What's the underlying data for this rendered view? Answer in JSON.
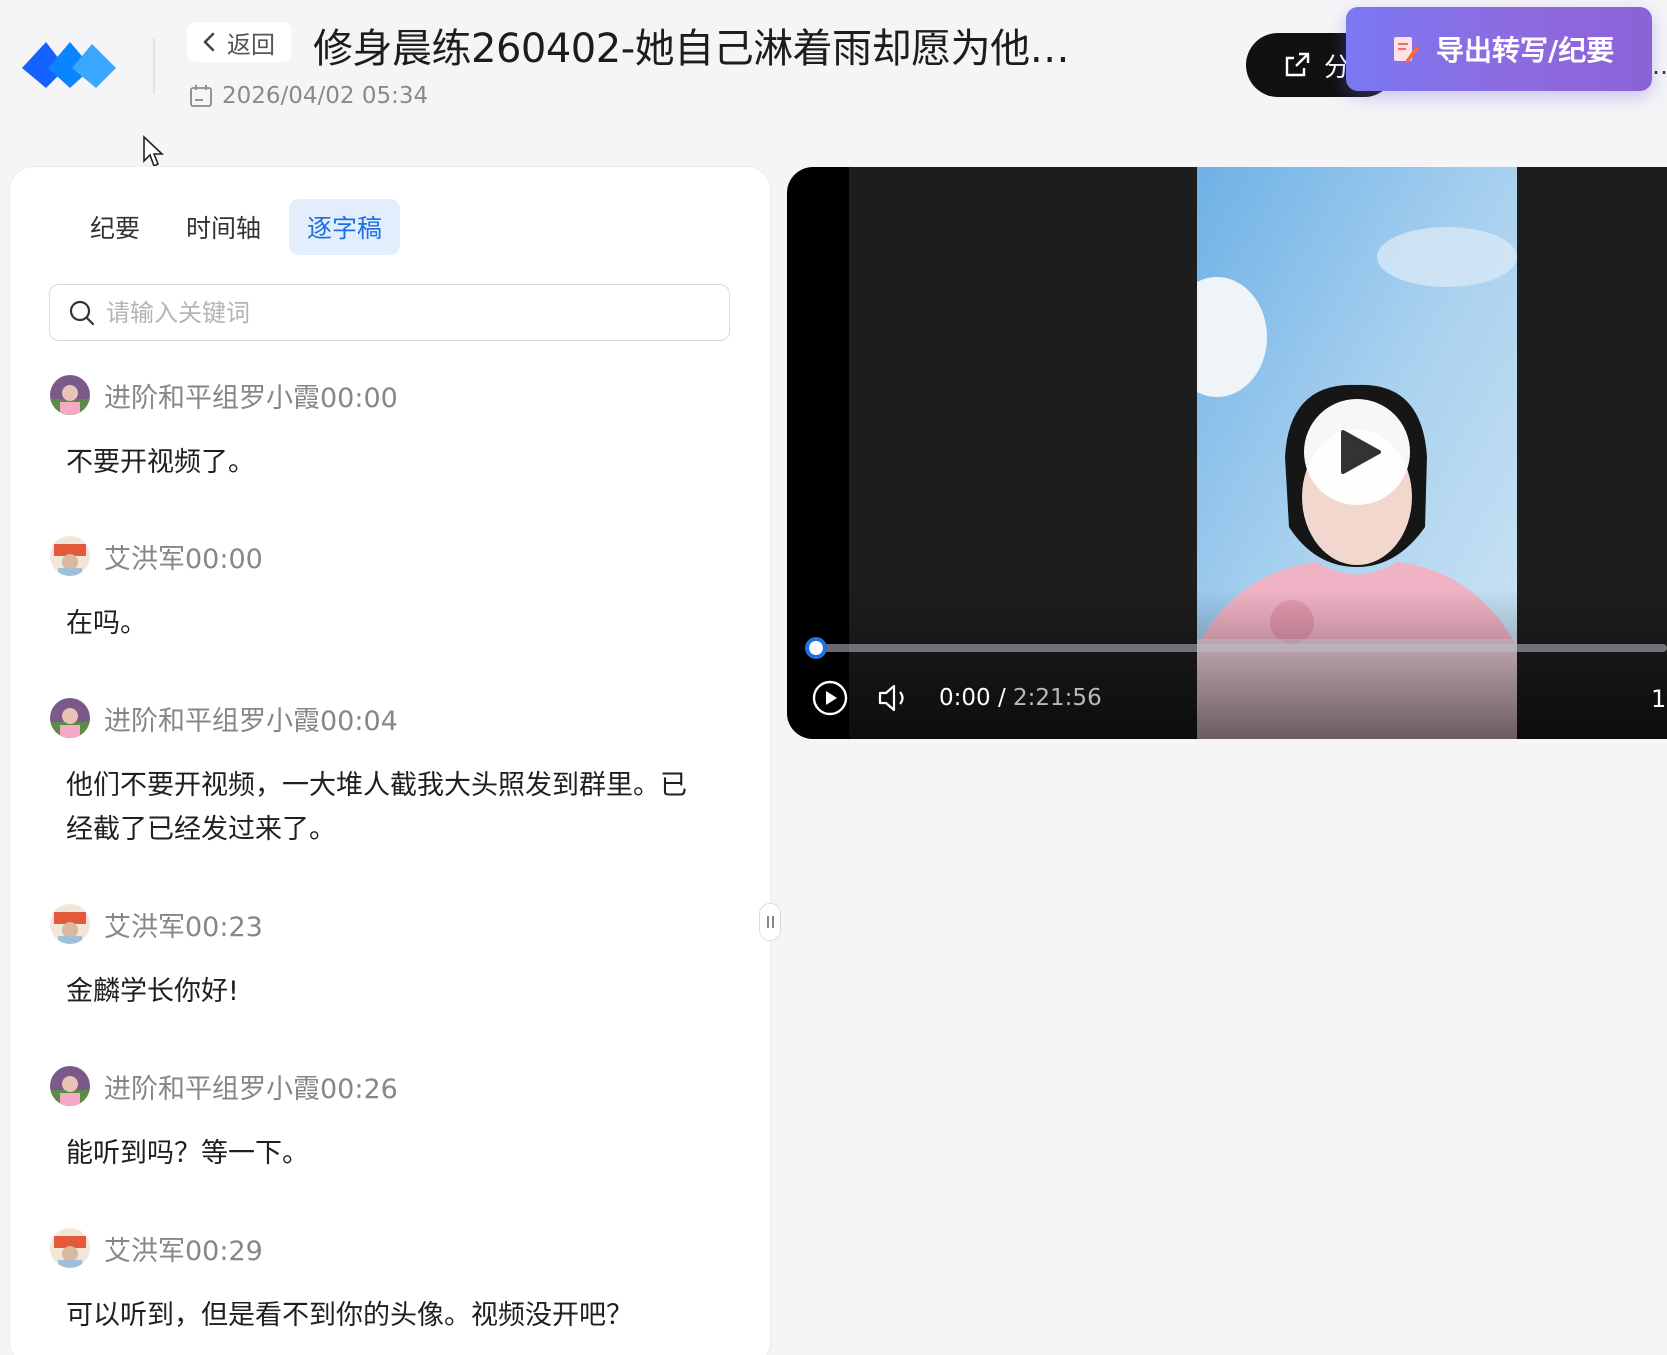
{
  "header": {
    "back_label": "返回",
    "title": "修身晨练260402-她自己淋着雨却愿为他…",
    "date": "2026/04/02 05:34",
    "share_label": "分",
    "export_label": "导出转写/纪要",
    "edge_glyph": "…"
  },
  "tabs": [
    {
      "label": "纪要",
      "active": false
    },
    {
      "label": "时间轴",
      "active": false
    },
    {
      "label": "逐字稿",
      "active": true
    }
  ],
  "search": {
    "placeholder": "请输入关键词",
    "value": ""
  },
  "transcript": [
    {
      "speaker": "进阶和平组罗小霞",
      "time": "00:00",
      "text": "不要开视频了。"
    },
    {
      "speaker": "艾洪军",
      "time": "00:00",
      "text": "在吗。"
    },
    {
      "speaker": "进阶和平组罗小霞",
      "time": "00:04",
      "text": "他们不要开视频，一大堆人截我大头照发到群里。已经截了已经发过来了。"
    },
    {
      "speaker": "艾洪军",
      "time": "00:23",
      "text": "金麟学长你好!"
    },
    {
      "speaker": "进阶和平组罗小霞",
      "time": "00:26",
      "text": "能听到吗？等一下。"
    },
    {
      "speaker": "艾洪军",
      "time": "00:29",
      "text": "可以听到，但是看不到你的头像。视频没开吧？"
    }
  ],
  "player": {
    "current": "0:00",
    "separator": " / ",
    "total": "2:21:56",
    "progress_fraction": 0.004,
    "speed_label": "1"
  },
  "colors": {
    "accent": "#1e6fe3",
    "tab_active_bg": "#e3eefc",
    "export_start": "#7a78f2",
    "export_end": "#8a63d6"
  },
  "icons": [
    "meeting-logo-icon",
    "chevron-left-icon",
    "calendar-icon",
    "share-icon",
    "document-edit-icon",
    "search-icon",
    "play-icon",
    "play-circle-icon",
    "volume-icon",
    "cursor-icon"
  ]
}
